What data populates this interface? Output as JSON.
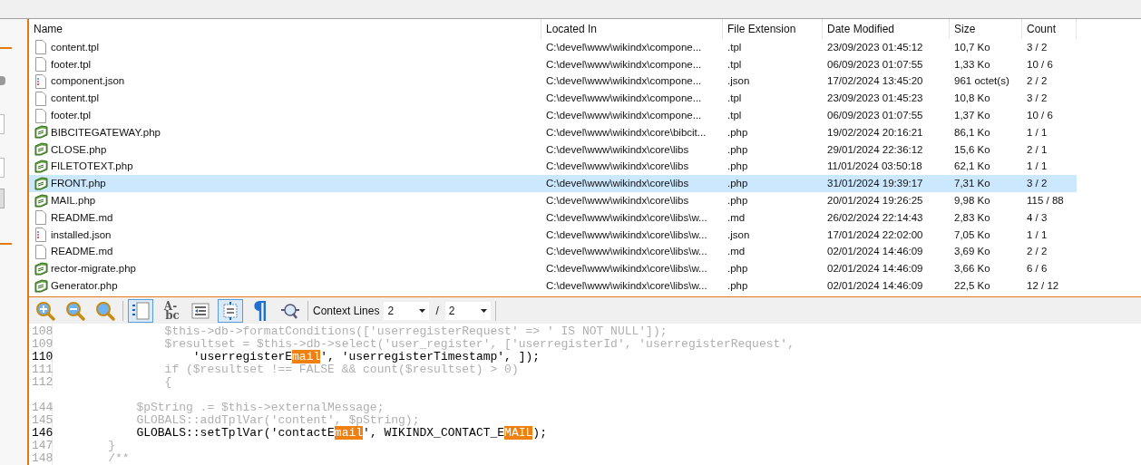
{
  "table": {
    "columns": [
      "Name",
      "Located In",
      "File Extension",
      "Date Modified",
      "Size",
      "Count"
    ],
    "rows": [
      {
        "kind": "plain",
        "selected": false,
        "cells": [
          "content.tpl",
          "C:\\devel\\www\\wikindx\\compone...",
          ".tpl",
          "23/09/2023 01:45:12",
          "10,7 Ko",
          "3 / 2"
        ]
      },
      {
        "kind": "plain",
        "selected": false,
        "cells": [
          "footer.tpl",
          "C:\\devel\\www\\wikindx\\compone...",
          ".tpl",
          "06/09/2023 01:07:55",
          "1,33 Ko",
          "10 / 6"
        ]
      },
      {
        "kind": "json",
        "selected": false,
        "cells": [
          "component.json",
          "C:\\devel\\www\\wikindx\\compone...",
          ".json",
          "17/02/2024 13:45:20",
          "961 octet(s)",
          "2 / 2"
        ]
      },
      {
        "kind": "plain",
        "selected": false,
        "cells": [
          "content.tpl",
          "C:\\devel\\www\\wikindx\\compone...",
          ".tpl",
          "23/09/2023 01:45:23",
          "10,8 Ko",
          "3 / 2"
        ]
      },
      {
        "kind": "plain",
        "selected": false,
        "cells": [
          "footer.tpl",
          "C:\\devel\\www\\wikindx\\compone...",
          ".tpl",
          "06/09/2023 01:07:55",
          "1,37 Ko",
          "10 / 6"
        ]
      },
      {
        "kind": "php",
        "selected": false,
        "cells": [
          "BIBCITEGATEWAY.php",
          "C:\\devel\\www\\wikindx\\core\\bibcit...",
          ".php",
          "19/02/2024 20:16:21",
          "86,1 Ko",
          "1 / 1"
        ]
      },
      {
        "kind": "php",
        "selected": false,
        "cells": [
          "CLOSE.php",
          "C:\\devel\\www\\wikindx\\core\\libs",
          ".php",
          "29/01/2024 22:36:12",
          "15,6 Ko",
          "2 / 1"
        ]
      },
      {
        "kind": "php",
        "selected": false,
        "cells": [
          "FILETOTEXT.php",
          "C:\\devel\\www\\wikindx\\core\\libs",
          ".php",
          "11/01/2024 03:50:18",
          "62,1 Ko",
          "1 / 1"
        ]
      },
      {
        "kind": "php",
        "selected": true,
        "cells": [
          "FRONT.php",
          "C:\\devel\\www\\wikindx\\core\\libs",
          ".php",
          "31/01/2024 19:39:17",
          "7,31 Ko",
          "3 / 2"
        ]
      },
      {
        "kind": "php",
        "selected": false,
        "cells": [
          "MAIL.php",
          "C:\\devel\\www\\wikindx\\core\\libs",
          ".php",
          "20/01/2024 19:26:25",
          "9,98 Ko",
          "115 / 88"
        ]
      },
      {
        "kind": "plain",
        "selected": false,
        "cells": [
          "README.md",
          "C:\\devel\\www\\wikindx\\core\\libs\\w...",
          ".md",
          "26/02/2024 22:14:43",
          "2,83 Ko",
          "4 / 3"
        ]
      },
      {
        "kind": "json",
        "selected": false,
        "cells": [
          "installed.json",
          "C:\\devel\\www\\wikindx\\core\\libs\\w...",
          ".json",
          "17/01/2024 22:02:00",
          "7,05 Ko",
          "1 / 1"
        ]
      },
      {
        "kind": "plain",
        "selected": false,
        "cells": [
          "README.md",
          "C:\\devel\\www\\wikindx\\core\\libs\\w...",
          ".md",
          "02/01/2024 14:46:09",
          "3,69 Ko",
          "2 / 2"
        ]
      },
      {
        "kind": "php",
        "selected": false,
        "cells": [
          "rector-migrate.php",
          "C:\\devel\\www\\wikindx\\core\\libs\\w...",
          ".php",
          "02/01/2024 14:46:09",
          "3,66 Ko",
          "6 / 6"
        ]
      },
      {
        "kind": "php",
        "selected": false,
        "cells": [
          "Generator.php",
          "C:\\devel\\www\\wikindx\\core\\libs\\w...",
          ".php",
          "02/01/2024 14:46:09",
          "22,5 Ko",
          "12 / 12"
        ]
      }
    ]
  },
  "toolbar": {
    "buttons": [
      {
        "kind": "zoom-in",
        "selected": false
      },
      {
        "kind": "zoom-out",
        "selected": false
      },
      {
        "kind": "zoom-reset",
        "selected": false
      },
      {
        "kind": "line-numbers",
        "selected": true
      },
      {
        "kind": "case",
        "selected": false,
        "glyph_top": "A-",
        "glyph_bottom": "bc"
      },
      {
        "kind": "indent",
        "selected": false
      },
      {
        "kind": "outline",
        "selected": true
      },
      {
        "kind": "pilcrow",
        "selected": false,
        "glyph": "¶"
      },
      {
        "kind": "find",
        "selected": false
      }
    ],
    "context_label": "Context Lines",
    "context_before": "2",
    "separator": "/",
    "context_after": "2"
  },
  "code": [
    {
      "kind": "line",
      "number": "108",
      "match": false,
      "segments": [
        {
          "text": "            $this->db->formatConditions(['userregisterRequest' => ' IS NOT NULL']);",
          "highlight": false
        }
      ]
    },
    {
      "kind": "line",
      "number": "109",
      "match": false,
      "segments": [
        {
          "text": "            $resultset = $this->db->select('user_register', ['userregisterId', 'userregisterRequest',",
          "highlight": false
        }
      ]
    },
    {
      "kind": "line",
      "number": "110",
      "match": true,
      "segments": [
        {
          "text": "                'userregisterE",
          "highlight": false
        },
        {
          "text": "mail",
          "highlight": true
        },
        {
          "text": "', 'userregisterTimestamp', ]);",
          "highlight": false
        }
      ]
    },
    {
      "kind": "line",
      "number": "111",
      "match": false,
      "segments": [
        {
          "text": "            if ($resultset !== FALSE && count($resultset) > 0)",
          "highlight": false
        }
      ]
    },
    {
      "kind": "line",
      "number": "112",
      "match": false,
      "segments": [
        {
          "text": "            {",
          "highlight": false
        }
      ]
    },
    {
      "kind": "gap"
    },
    {
      "kind": "line",
      "number": "144",
      "match": false,
      "segments": [
        {
          "text": "        $pString .= $this->externalMessage;",
          "highlight": false
        }
      ]
    },
    {
      "kind": "line",
      "number": "145",
      "match": false,
      "segments": [
        {
          "text": "        GLOBALS::addTplVar('content', $pString);",
          "highlight": false
        }
      ]
    },
    {
      "kind": "line",
      "number": "146",
      "match": true,
      "segments": [
        {
          "text": "        GLOBALS::setTplVar('contactE",
          "highlight": false
        },
        {
          "text": "mail",
          "highlight": true
        },
        {
          "text": "', WIKINDX_CONTACT_E",
          "highlight": false
        },
        {
          "text": "MAIL",
          "highlight": true
        },
        {
          "text": ");",
          "highlight": false
        }
      ]
    },
    {
      "kind": "line",
      "number": "147",
      "match": false,
      "segments": [
        {
          "text": "    }",
          "highlight": false
        }
      ]
    },
    {
      "kind": "line",
      "number": "148",
      "match": false,
      "segments": [
        {
          "text": "    /**",
          "highlight": false
        }
      ]
    }
  ]
}
